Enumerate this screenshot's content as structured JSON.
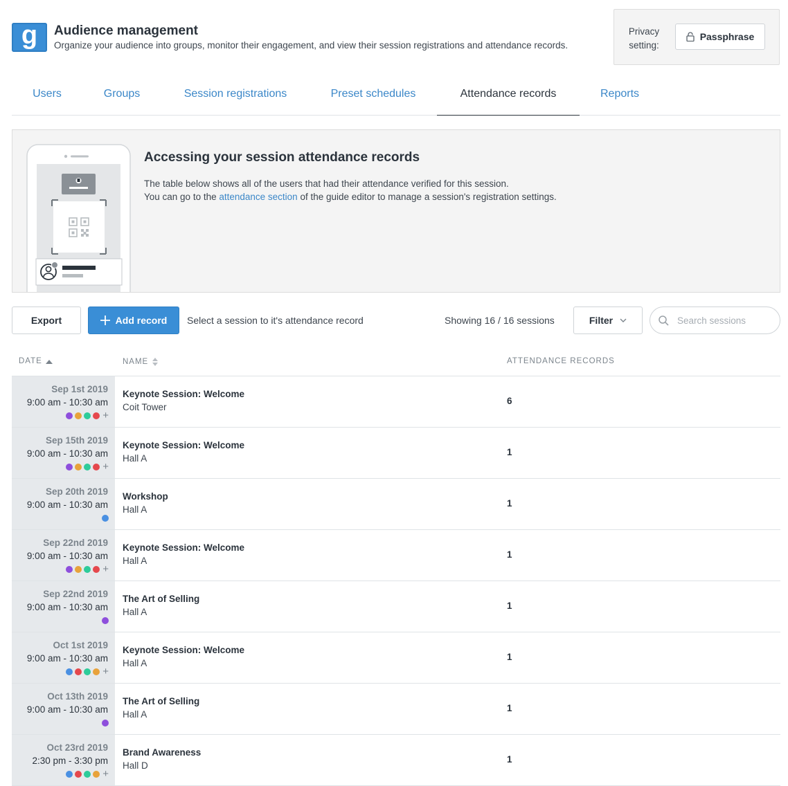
{
  "header": {
    "logo_letter": "g",
    "title": "Audience management",
    "subtitle": "Organize your audience into groups, monitor their engagement,  and view their session registrations and attendance records."
  },
  "privacy": {
    "label": "Privacy setting:",
    "button_label": "Passphrase"
  },
  "tabs": [
    {
      "label": "Users",
      "active": false
    },
    {
      "label": "Groups",
      "active": false
    },
    {
      "label": "Session registrations",
      "active": false
    },
    {
      "label": "Preset schedules",
      "active": false
    },
    {
      "label": "Attendance records",
      "active": true
    },
    {
      "label": "Reports",
      "active": false
    }
  ],
  "info": {
    "title": "Accessing your session attendance records",
    "line1": "The table below shows all of the users that had their attendance verified for this session.",
    "line2_prefix": "You can go to the ",
    "line2_link": "attendance section",
    "line2_suffix": " of the guide editor to manage a session's registration settings."
  },
  "toolbar": {
    "export_label": "Export",
    "add_label": "Add record",
    "hint": "Select a session to it's attendance record",
    "showing": "Showing 16 / 16 sessions",
    "filter_label": "Filter",
    "search_placeholder": "Search sessions"
  },
  "table": {
    "columns": {
      "date": "DATE",
      "name": "NAME",
      "records": "ATTENDANCE RECORDS"
    },
    "rows": [
      {
        "day": "Sep 1st 2019",
        "time": "9:00 am - 10:30 am",
        "title": "Keynote Session: Welcome",
        "location": "Coit Tower",
        "count": "6",
        "dots": [
          "#8e4fdc",
          "#e8a23b",
          "#2ecc9a",
          "#e5484d"
        ],
        "more": true
      },
      {
        "day": "Sep 15th 2019",
        "time": "9:00 am - 10:30 am",
        "title": "Keynote Session: Welcome",
        "location": "Hall A",
        "count": "1",
        "dots": [
          "#8e4fdc",
          "#e8a23b",
          "#2ecc9a",
          "#e5484d"
        ],
        "more": true
      },
      {
        "day": "Sep 20th 2019",
        "time": "9:00 am - 10:30 am",
        "title": "Workshop",
        "location": "Hall A",
        "count": "1",
        "dots": [
          "#4a90e2"
        ],
        "more": false
      },
      {
        "day": "Sep 22nd 2019",
        "time": "9:00 am - 10:30 am",
        "title": "Keynote Session: Welcome",
        "location": "Hall A",
        "count": "1",
        "dots": [
          "#8e4fdc",
          "#e8a23b",
          "#2ecc9a",
          "#e5484d"
        ],
        "more": true
      },
      {
        "day": "Sep 22nd 2019",
        "time": "9:00 am - 10:30 am",
        "title": "The Art of Selling",
        "location": "Hall A",
        "count": "1",
        "dots": [
          "#8e4fdc"
        ],
        "more": false
      },
      {
        "day": "Oct 1st 2019",
        "time": "9:00 am - 10:30 am",
        "title": "Keynote Session: Welcome",
        "location": "Hall A",
        "count": "1",
        "dots": [
          "#4a90e2",
          "#e5484d",
          "#2ecc9a",
          "#e8a23b"
        ],
        "more": true
      },
      {
        "day": "Oct 13th 2019",
        "time": "9:00 am - 10:30 am",
        "title": "The Art of Selling",
        "location": "Hall A",
        "count": "1",
        "dots": [
          "#8e4fdc"
        ],
        "more": false
      },
      {
        "day": "Oct 23rd 2019",
        "time": "2:30 pm - 3:30 pm",
        "title": "Brand Awareness",
        "location": "Hall D",
        "count": "1",
        "dots": [
          "#4a90e2",
          "#e5484d",
          "#2ecc9a",
          "#e8a23b"
        ],
        "more": true
      }
    ]
  },
  "icons": {
    "logo": "guidebook-logo-icon",
    "lock": "lock-icon",
    "plus": "plus-icon",
    "chevron": "chevron-down-icon",
    "search": "search-icon",
    "sort_asc": "sort-ascending-icon",
    "sort_both": "sort-icon",
    "illustration": "phone-qr-checkin-illustration"
  }
}
